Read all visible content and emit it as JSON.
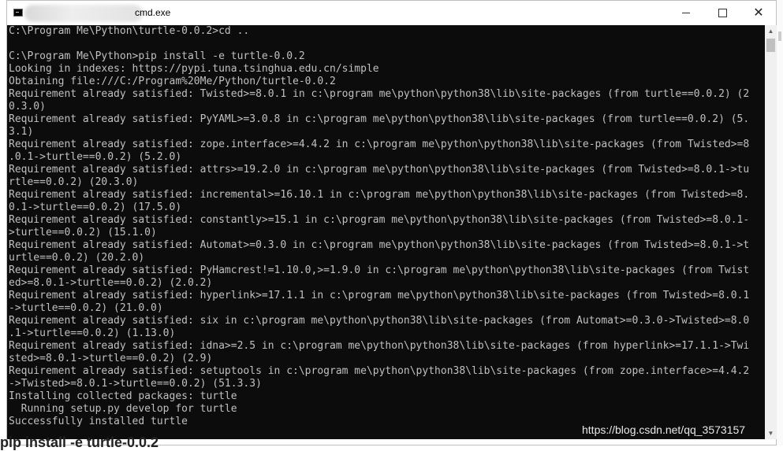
{
  "window": {
    "title": "cmd.exe",
    "minimize_label": "minimize",
    "maximize_label": "maximize",
    "close_label": "close"
  },
  "console": {
    "lines": [
      "C:\\Program Me\\Python\\turtle-0.0.2>cd ..",
      "",
      "C:\\Program Me\\Python>pip install -e turtle-0.0.2",
      "Looking in indexes: https://pypi.tuna.tsinghua.edu.cn/simple",
      "Obtaining file:///C:/Program%20Me/Python/turtle-0.0.2",
      "Requirement already satisfied: Twisted>=8.0.1 in c:\\program me\\python\\python38\\lib\\site-packages (from turtle==0.0.2) (2",
      "0.3.0)",
      "Requirement already satisfied: PyYAML>=3.0.8 in c:\\program me\\python\\python38\\lib\\site-packages (from turtle==0.0.2) (5.",
      "3.1)",
      "Requirement already satisfied: zope.interface>=4.4.2 in c:\\program me\\python\\python38\\lib\\site-packages (from Twisted>=8",
      ".0.1->turtle==0.0.2) (5.2.0)",
      "Requirement already satisfied: attrs>=19.2.0 in c:\\program me\\python\\python38\\lib\\site-packages (from Twisted>=8.0.1->tu",
      "rtle==0.0.2) (20.3.0)",
      "Requirement already satisfied: incremental>=16.10.1 in c:\\program me\\python\\python38\\lib\\site-packages (from Twisted>=8.",
      "0.1->turtle==0.0.2) (17.5.0)",
      "Requirement already satisfied: constantly>=15.1 in c:\\program me\\python\\python38\\lib\\site-packages (from Twisted>=8.0.1-",
      ">turtle==0.0.2) (15.1.0)",
      "Requirement already satisfied: Automat>=0.3.0 in c:\\program me\\python\\python38\\lib\\site-packages (from Twisted>=8.0.1->t",
      "urtle==0.0.2) (20.2.0)",
      "Requirement already satisfied: PyHamcrest!=1.10.0,>=1.9.0 in c:\\program me\\python\\python38\\lib\\site-packages (from Twist",
      "ed>=8.0.1->turtle==0.0.2) (2.0.2)",
      "Requirement already satisfied: hyperlink>=17.1.1 in c:\\program me\\python\\python38\\lib\\site-packages (from Twisted>=8.0.1",
      "->turtle==0.0.2) (21.0.0)",
      "Requirement already satisfied: six in c:\\program me\\python\\python38\\lib\\site-packages (from Automat>=0.3.0->Twisted>=8.0",
      ".1->turtle==0.0.2) (1.13.0)",
      "Requirement already satisfied: idna>=2.5 in c:\\program me\\python\\python38\\lib\\site-packages (from hyperlink>=17.1.1->Twi",
      "sted>=8.0.1->turtle==0.0.2) (2.9)",
      "Requirement already satisfied: setuptools in c:\\program me\\python\\python38\\lib\\site-packages (from zope.interface>=4.4.2",
      "->Twisted>=8.0.1->turtle==0.0.2) (51.3.3)",
      "Installing collected packages: turtle",
      "  Running setup.py develop for turtle",
      "Successfully installed turtle"
    ]
  },
  "watermark": "https://blog.csdn.net/qq_3573157",
  "background_text": "pip install -e turtle-0.0.2",
  "colors": {
    "console_bg": "#0c0c0c",
    "console_fg": "#c0c0c0",
    "titlebar_bg": "#ffffff"
  }
}
